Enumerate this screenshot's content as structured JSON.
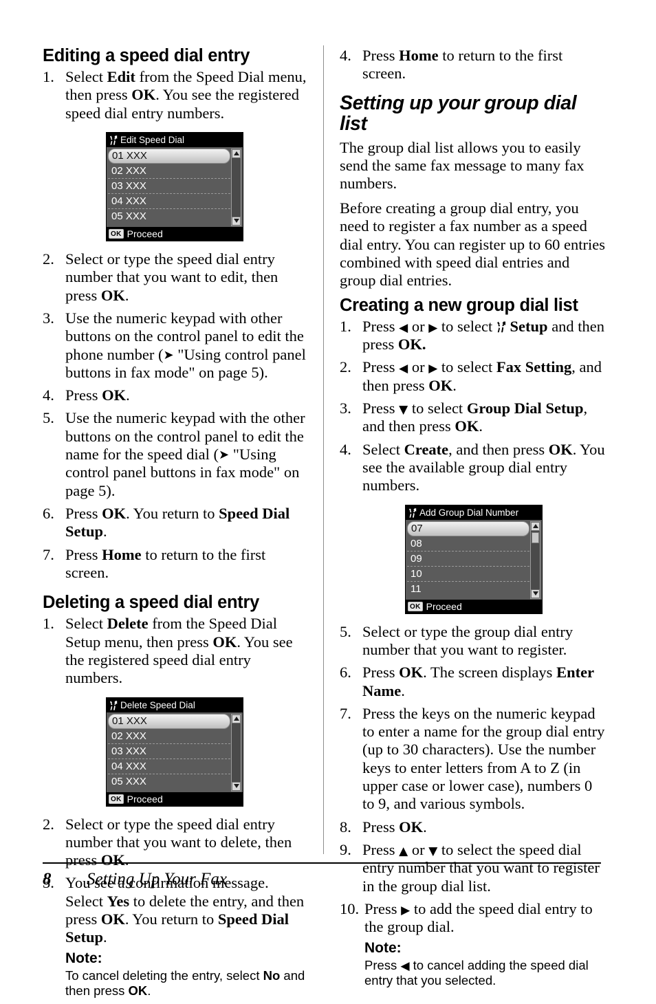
{
  "document": {
    "footer": {
      "page_number": "8",
      "title": "Setting Up Your Fax"
    }
  },
  "left_column": {
    "heading_edit": "Editing a speed dial entry",
    "edit_steps": [
      {
        "num": "1.",
        "text_html": "Select <b>Edit</b> from the Speed Dial menu, then press <b>OK</b>. You see the registered speed dial entry numbers."
      },
      {
        "num": "2.",
        "text_html": "Select or type the speed dial entry number that you want to edit, then press <b>OK</b>."
      },
      {
        "num": "3.",
        "text_html": "Use the numeric keypad with other buttons on the control panel to edit the phone number (<span class=\"ref-arrow\">&#10148;</span> \"Using control panel buttons in fax mode\" on page 5)."
      },
      {
        "num": "4.",
        "text_html": "Press <b>OK</b>."
      },
      {
        "num": "5.",
        "text_html": "Use the numeric keypad with the other buttons on the control panel to edit the name for the speed dial (<span class=\"ref-arrow\">&#10148;</span> \"Using control panel buttons in fax mode\" on page 5)."
      },
      {
        "num": "6.",
        "text_html": "Press <b>OK</b>. You return to <b>Speed Dial Setup</b>."
      },
      {
        "num": "7.",
        "text_html": "Press <b>Home</b> to return to the first screen."
      }
    ],
    "heading_delete": "Deleting a speed dial entry",
    "delete_steps": [
      {
        "num": "1.",
        "text_html": "Select <b>Delete</b> from the Speed Dial Setup menu, then press <b>OK</b>. You see the registered speed dial entry numbers."
      },
      {
        "num": "2.",
        "text_html": "Select or type the speed dial entry number that you want to delete, then press <b>OK</b>."
      },
      {
        "num": "3.",
        "text_html": "You see a confirmation message. Select <b>Yes</b> to delete the entry, and then press <b>OK</b>. You return to <b>Speed Dial Setup</b>."
      }
    ],
    "note": {
      "title": "Note:",
      "text_html": "To cancel deleting the entry, select <b>No</b> and then press <b>OK</b>."
    }
  },
  "right_column": {
    "step4_html": "Press <b>Home</b> to return to the first screen.",
    "step4_num": "4.",
    "chapter_heading": "Setting up your group dial list",
    "intro_para_1": "The group dial list allows you to easily send the same fax message to many fax numbers.",
    "intro_para_2": "Before creating a group dial entry, you need to register a fax number as a speed dial entry. You can register up to 60 entries combined with speed dial entries and group dial entries.",
    "heading_create": "Creating a new group dial list",
    "create_steps": [
      {
        "num": "1.",
        "text_html": "Press <span class=\"tri\">&#9664;</span> or <span class=\"tri\">&#9654;</span> to select <b><span class=\"inline-tool\"></span> Setup</b> and then press <b>OK.</b>"
      },
      {
        "num": "2.",
        "text_html": "Press <span class=\"tri\">&#9664;</span> or <span class=\"tri\">&#9654;</span> to select <b>Fax Setting</b>, and then press <b>OK</b>."
      },
      {
        "num": "3.",
        "text_html": "Press <span class=\"tri\">&#9660;</span> to select <b>Group Dial Setup</b>, and then press <b>OK</b>."
      },
      {
        "num": "4.",
        "text_html": "Select <b>Create</b>, and then press <b>OK</b>. You see the available group dial entry numbers."
      }
    ],
    "create_steps_after": [
      {
        "num": "5.",
        "text_html": "Select or type the group dial entry number that you want to register."
      },
      {
        "num": "6.",
        "text_html": "Press <b>OK</b>. The screen displays <b>Enter Name</b>."
      },
      {
        "num": "7.",
        "text_html": "Press the keys on the numeric keypad to enter a name for the group dial entry (up to 30 characters). Use the number keys to enter letters from A to Z (in upper case or lower case), numbers 0 to 9, and various symbols."
      },
      {
        "num": "8.",
        "text_html": "Press <b>OK</b>."
      },
      {
        "num": "9.",
        "text_html": "Press <span class=\"tri\">&#9650;</span> or <span class=\"tri\">&#9660;</span> to select the speed dial entry number that you want to register in the group dial list."
      },
      {
        "num": "10.",
        "text_html": "Press <span class=\"tri\">&#9654;</span> to add the speed dial entry to the group dial."
      }
    ],
    "note": {
      "title": "Note:",
      "text_html": "Press <span class=\"tri\">&#9664;</span> to cancel adding the speed dial entry that you selected."
    }
  },
  "lcd_screens": {
    "edit_speed_dial": {
      "title": "Edit Speed Dial",
      "title_icon": "setup-tools-icon",
      "rows": [
        "01 XXX",
        "02 XXX",
        "03 XXX",
        "04 XXX",
        "05 XXX"
      ],
      "selected_index": 0,
      "footer_badge": "OK",
      "footer_label": "Proceed",
      "scrollbar": {
        "up_arrow": true,
        "down_arrow": true,
        "thumb": false
      }
    },
    "delete_speed_dial": {
      "title": "Delete Speed Dial",
      "title_icon": "setup-tools-icon",
      "rows": [
        "01 XXX",
        "02 XXX",
        "03 XXX",
        "04 XXX",
        "05 XXX"
      ],
      "selected_index": 0,
      "footer_badge": "OK",
      "footer_label": "Proceed",
      "scrollbar": {
        "up_arrow": true,
        "down_arrow": true,
        "thumb": false
      }
    },
    "add_group_dial_number": {
      "title": "Add Group Dial Number",
      "title_icon": "setup-tools-icon",
      "rows": [
        "07",
        "08",
        "09",
        "10",
        "11"
      ],
      "selected_index": 0,
      "footer_badge": "OK",
      "footer_label": "Proceed",
      "scrollbar": {
        "up_arrow": true,
        "down_arrow": true,
        "thumb": true
      }
    }
  },
  "colors": {
    "lcd_background": "#5b5b5b",
    "lcd_title_bar": "#000000",
    "lcd_selected_row": "#e2e2e2",
    "text": "#000000",
    "divider": "#8d8d8d"
  }
}
